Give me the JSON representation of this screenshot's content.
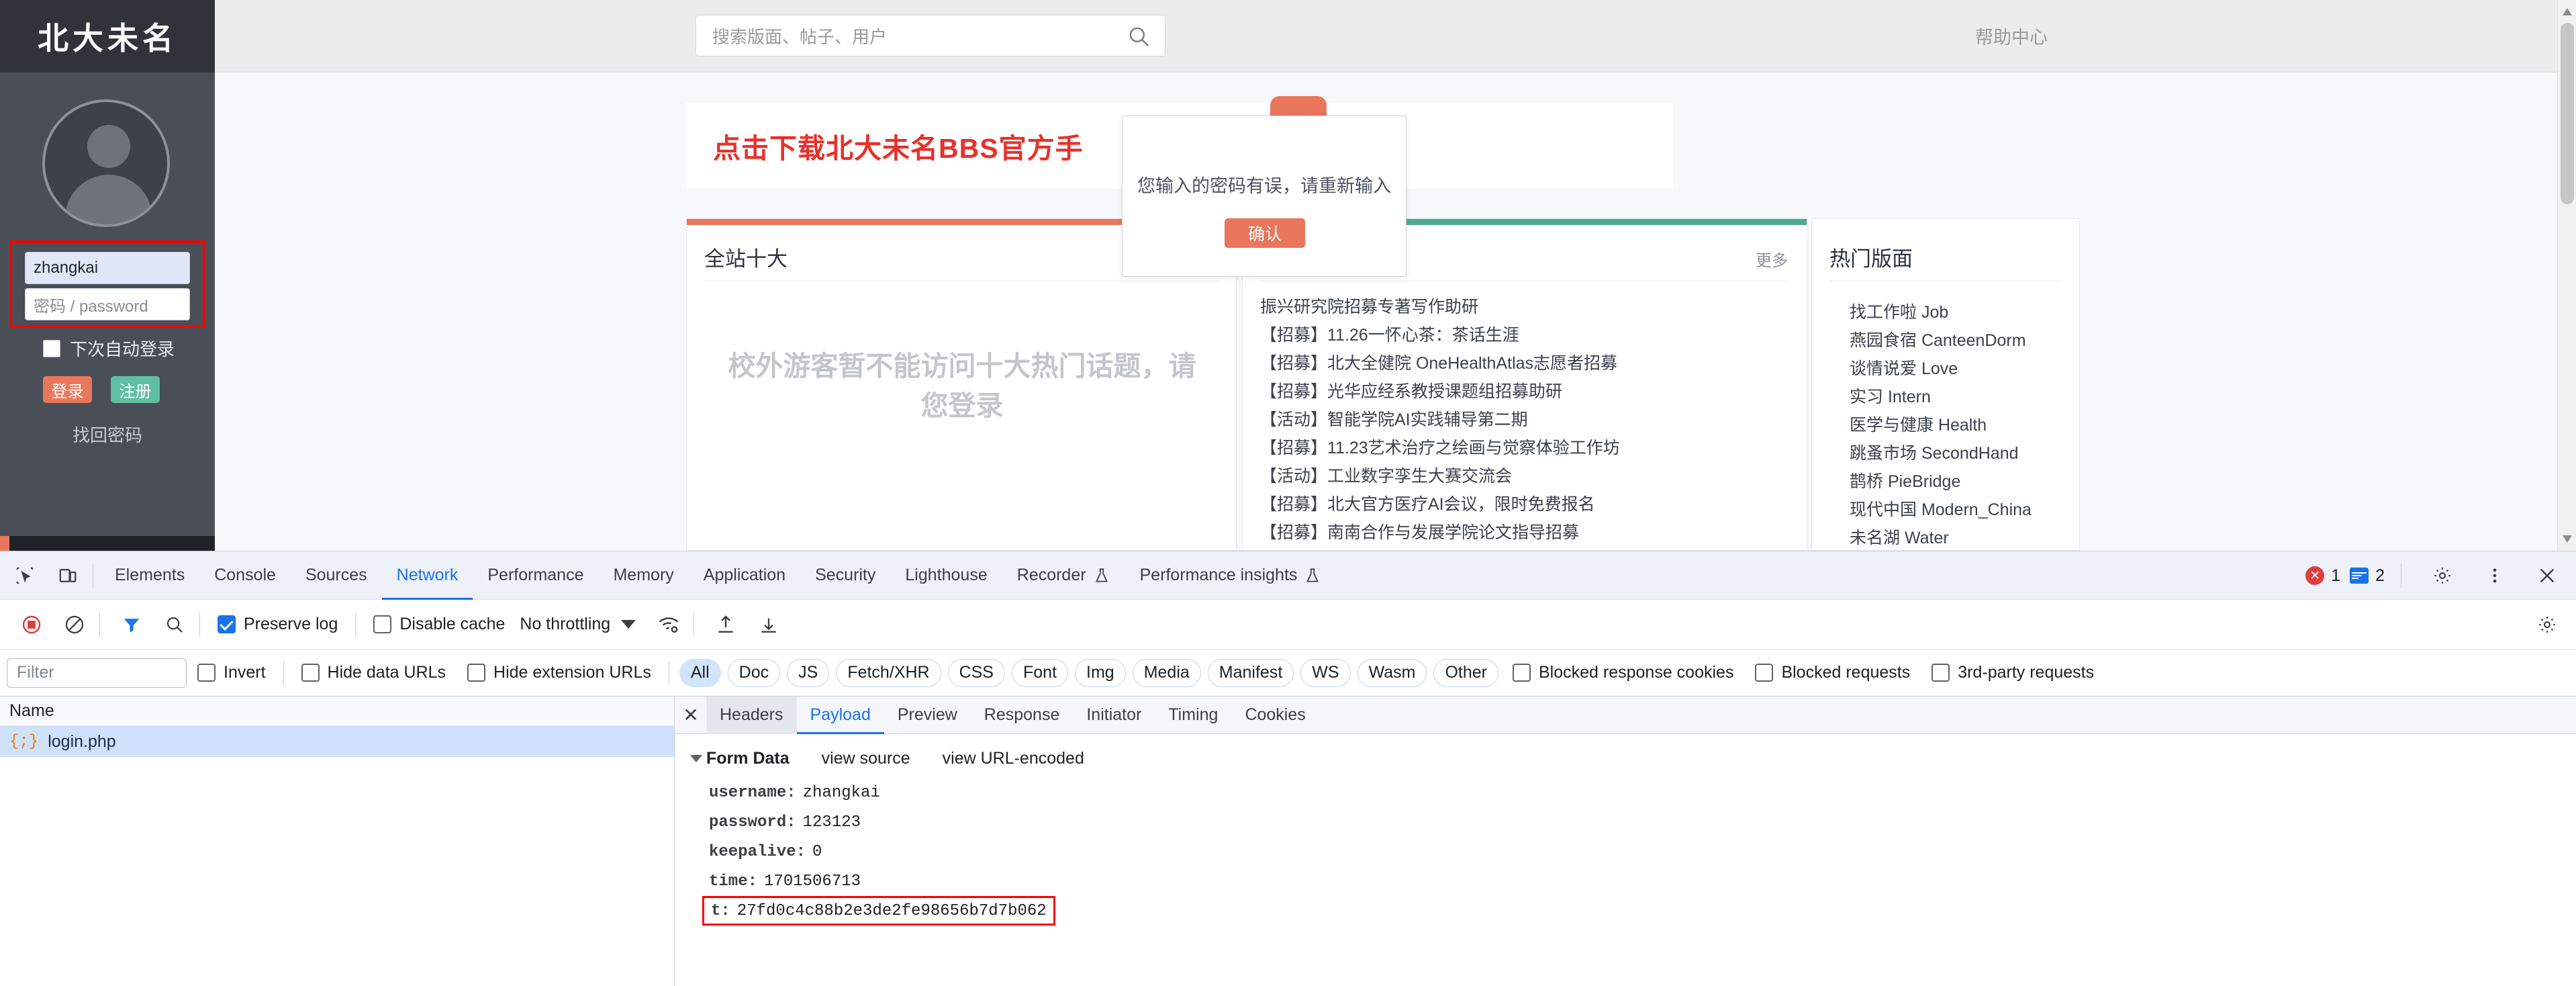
{
  "colors": {
    "brand_dark": "#30343a",
    "sidebar": "#4a4f57",
    "accent_orange": "#e8775c",
    "accent_green": "#4cab92",
    "banner_red": "#e8302a",
    "devtools_blue": "#1a73e8",
    "highlight_red": "#ff0000"
  },
  "site": {
    "brand": "北大未名",
    "search": {
      "placeholder": "搜索版面、帖子、用户",
      "icon": "search-icon"
    },
    "help_center": "帮助中心"
  },
  "login": {
    "username_value": "zhangkai",
    "password_placeholder": "密码 / password",
    "auto_login_label": "下次自动登录",
    "login_button": "登录",
    "register_button": "注册",
    "forgot_password": "找回密码"
  },
  "banner": {
    "text": "点击下载北大未名BBS官方手"
  },
  "modal": {
    "message": "您输入的密码有误，请重新输入",
    "confirm_label": "确认"
  },
  "top10": {
    "title": "全站十大",
    "guest_message": "校外游客暂不能访问十大热门话题，请您登录"
  },
  "posts": {
    "more_label": "更多",
    "items": [
      "振兴研究院招募专著写作助研",
      "【招募】11.26一怀心茶：茶话生涯",
      "【招募】北大全健院 OneHealthAtlas志愿者招募",
      "【招募】光华应经系教授课题组招募助研",
      "【活动】智能学院AI实践辅导第二期",
      "【招募】11.23艺术治疗之绘画与觉察体验工作坊",
      "【活动】工业数字孪生大赛交流会",
      "【招募】北大官方医疗AI会议，限时免费报名",
      "【招募】南南合作与发展学院论文指导招募"
    ]
  },
  "boards": {
    "title": "热门版面",
    "items": [
      "找工作啦 Job",
      "燕园食宿 CanteenDorm",
      "谈情说爱 Love",
      "实习 Intern",
      "医学与健康 Health",
      "跳蚤市场 SecondHand",
      "鹊桥 PieBridge",
      "现代中国 Modern_China",
      "未名湖 Water"
    ]
  },
  "devtools": {
    "tabs": [
      {
        "label": "Elements",
        "active": false,
        "experimental": false
      },
      {
        "label": "Console",
        "active": false,
        "experimental": false
      },
      {
        "label": "Sources",
        "active": false,
        "experimental": false
      },
      {
        "label": "Network",
        "active": true,
        "experimental": false
      },
      {
        "label": "Performance",
        "active": false,
        "experimental": false
      },
      {
        "label": "Memory",
        "active": false,
        "experimental": false
      },
      {
        "label": "Application",
        "active": false,
        "experimental": false
      },
      {
        "label": "Security",
        "active": false,
        "experimental": false
      },
      {
        "label": "Lighthouse",
        "active": false,
        "experimental": false
      },
      {
        "label": "Recorder",
        "active": false,
        "experimental": true
      },
      {
        "label": "Performance insights",
        "active": false,
        "experimental": true
      }
    ],
    "error_count": "1",
    "message_count": "2",
    "controls": {
      "preserve_log": "Preserve log",
      "preserve_log_checked": true,
      "disable_cache": "Disable cache",
      "disable_cache_checked": false,
      "throttling": "No throttling"
    },
    "filterbar": {
      "filter_placeholder": "Filter",
      "invert": "Invert",
      "hide_data_urls": "Hide data URLs",
      "hide_extension_urls": "Hide extension URLs",
      "types": [
        "All",
        "Doc",
        "JS",
        "Fetch/XHR",
        "CSS",
        "Font",
        "Img",
        "Media",
        "Manifest",
        "WS",
        "Wasm",
        "Other"
      ],
      "active_type": "All",
      "blocked_response_cookies": "Blocked response cookies",
      "blocked_requests": "Blocked requests",
      "third_party_requests": "3rd-party requests"
    },
    "requests": {
      "column_name": "Name",
      "rows": [
        {
          "name": "login.php",
          "icon": "script-icon",
          "selected": true
        }
      ]
    },
    "detail": {
      "tabs": [
        "Headers",
        "Payload",
        "Preview",
        "Response",
        "Initiator",
        "Timing",
        "Cookies"
      ],
      "active_tab": "Payload",
      "hovered_tab": "Headers",
      "form_data": {
        "section_title": "Form Data",
        "view_source": "view source",
        "view_url_encoded": "view URL-encoded",
        "entries": [
          {
            "key": "username:",
            "value": "zhangkai",
            "highlighted": false
          },
          {
            "key": "password:",
            "value": "123123",
            "highlighted": false
          },
          {
            "key": "keepalive:",
            "value": "0",
            "highlighted": false
          },
          {
            "key": "time:",
            "value": "1701506713",
            "highlighted": false
          },
          {
            "key": "t:",
            "value": "27fd0c4c88b2e3de2fe98656b7d7b062",
            "highlighted": true
          }
        ]
      }
    }
  }
}
